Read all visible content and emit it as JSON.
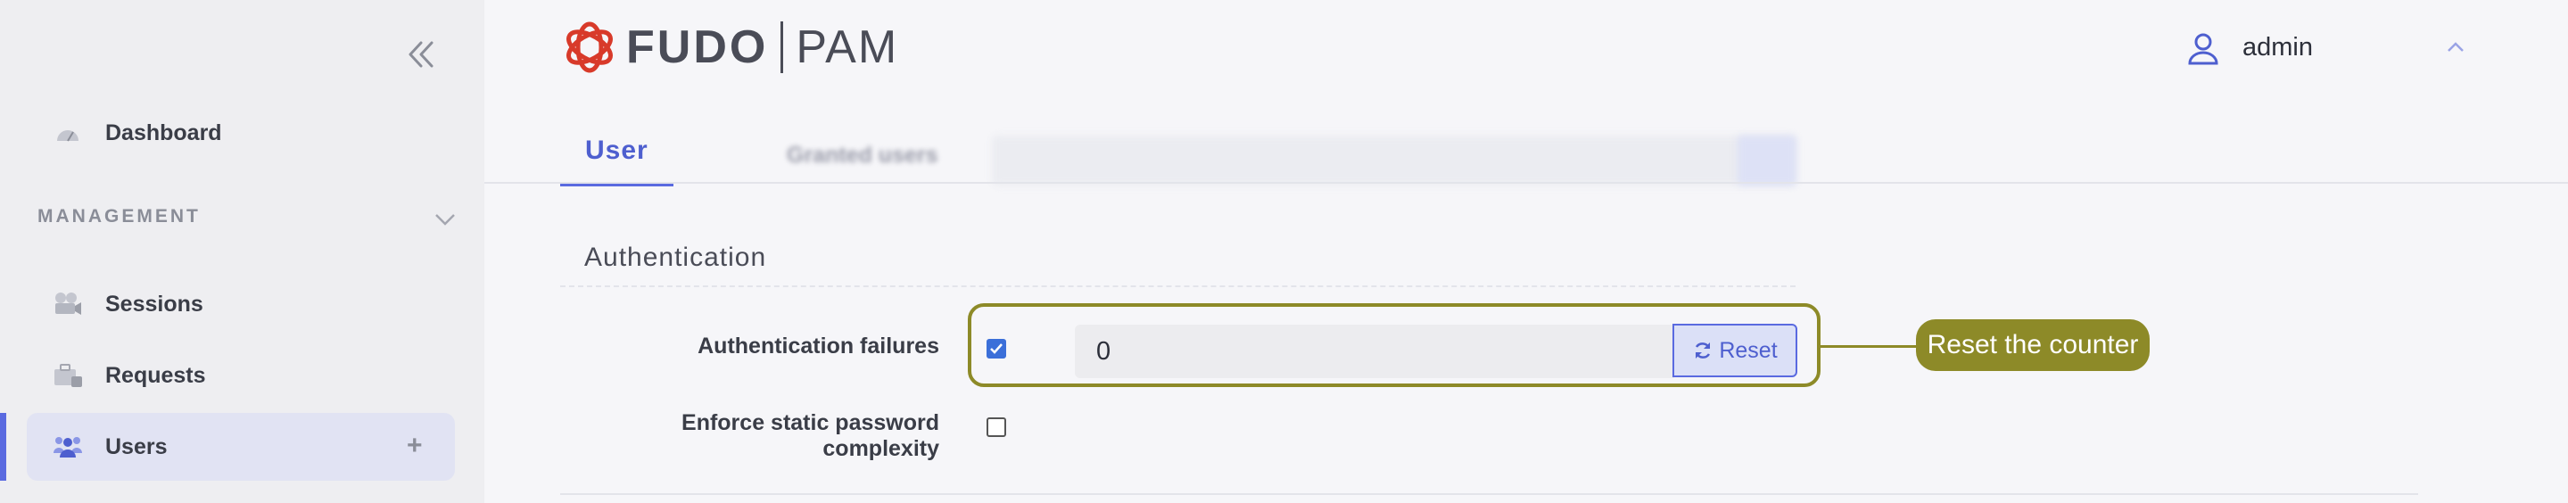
{
  "header": {
    "logo_text": "FUDO",
    "logo_product": "PAM",
    "user_name": "admin"
  },
  "sidebar": {
    "items": [
      {
        "label": "Dashboard",
        "icon": "dashboard-icon"
      },
      {
        "label": "Sessions",
        "icon": "sessions-icon"
      },
      {
        "label": "Requests",
        "icon": "requests-icon"
      },
      {
        "label": "Users",
        "icon": "users-icon",
        "active": true
      }
    ],
    "section_label": "MANAGEMENT",
    "add_symbol": "+"
  },
  "tabs": [
    {
      "label": "User",
      "active": true
    },
    {
      "label": "Granted users",
      "active": false
    }
  ],
  "form": {
    "section_title": "Authentication",
    "auth_failures_label": "Authentication failures",
    "auth_failures_checked": true,
    "auth_failures_value": "0",
    "reset_label": "Reset",
    "password_label_line1": "Enforce static password",
    "password_label_line2": "complexity",
    "password_checked": false
  },
  "callout": {
    "text": "Reset the counter"
  },
  "colors": {
    "accent": "#5a6ae0",
    "callout": "#8d8a28",
    "logo_red": "#d83a2a"
  }
}
